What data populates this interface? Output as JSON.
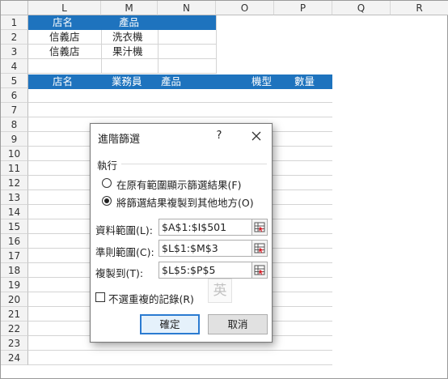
{
  "columns": [
    "L",
    "M",
    "N",
    "O",
    "P",
    "Q",
    "R"
  ],
  "rows": [
    "1",
    "2",
    "3",
    "4",
    "5",
    "6",
    "7",
    "8",
    "9",
    "10",
    "11",
    "12",
    "13",
    "14",
    "15",
    "16",
    "17",
    "18",
    "19",
    "20",
    "21",
    "22",
    "23",
    "24"
  ],
  "criteria": {
    "headers": [
      "店名",
      "產品"
    ],
    "rows": [
      [
        "信義店",
        "洗衣機"
      ],
      [
        "信義店",
        "果汁機"
      ]
    ]
  },
  "output_headers": [
    "店名",
    "業務員",
    "產品",
    "機型",
    "數量"
  ],
  "dialog": {
    "title": "進階篩選",
    "help": "?",
    "group_label": "執行",
    "option1": "在原有範圍顯示篩選結果(F)",
    "option2": "將篩選結果複製到其他地方(O)",
    "list_range_label": "資料範圍(L):",
    "list_range_value": "$A$1:$I$501",
    "criteria_range_label": "準則範圍(C):",
    "criteria_range_value": "$L$1:$M$3",
    "copy_to_label": "複製到(T):",
    "copy_to_value": "$L$5:$P$5",
    "unique_label": "不選重複的記錄(R)",
    "ime_indicator": "英",
    "ok": "確定",
    "cancel": "取消",
    "option_selected": "option2",
    "unique_checked": false
  },
  "colors": {
    "header_band": "#1e73be",
    "ok_border": "#2b7bd1"
  },
  "icons": [
    "close-icon",
    "range-picker-icon"
  ]
}
